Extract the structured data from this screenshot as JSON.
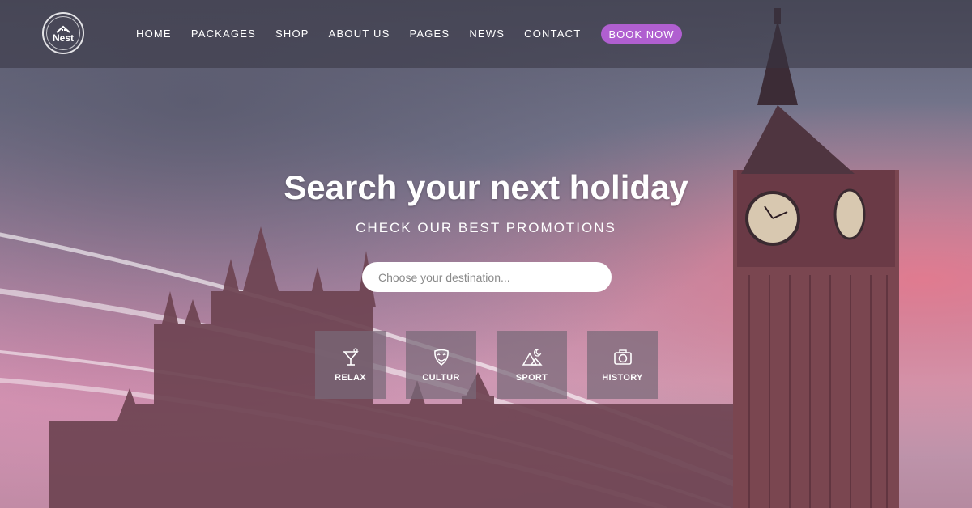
{
  "brand": {
    "name": "Nest",
    "icon": "house-icon"
  },
  "nav": {
    "items": [
      {
        "label": "HOME"
      },
      {
        "label": "PACKAGES"
      },
      {
        "label": "SHOP"
      },
      {
        "label": "ABOUT US"
      },
      {
        "label": "PAGES"
      },
      {
        "label": "NEWS"
      },
      {
        "label": "CONTACT"
      }
    ],
    "book_label": "BOOK NOW"
  },
  "hero": {
    "title": "Search your next holiday",
    "subtitle": "CHECK OUR BEST PROMOTIONS",
    "search_placeholder": "Choose your destination...",
    "search_value": ""
  },
  "categories": [
    {
      "label": "RELAX",
      "icon": "cocktail-icon"
    },
    {
      "label": "CULTUR",
      "icon": "theater-mask-icon"
    },
    {
      "label": "SPORT",
      "icon": "mountain-moon-icon"
    },
    {
      "label": "HISTORY",
      "icon": "camera-icon"
    }
  ],
  "colors": {
    "accent": "#b05fd0",
    "topbar": "#37344289",
    "tile": "#786978"
  }
}
